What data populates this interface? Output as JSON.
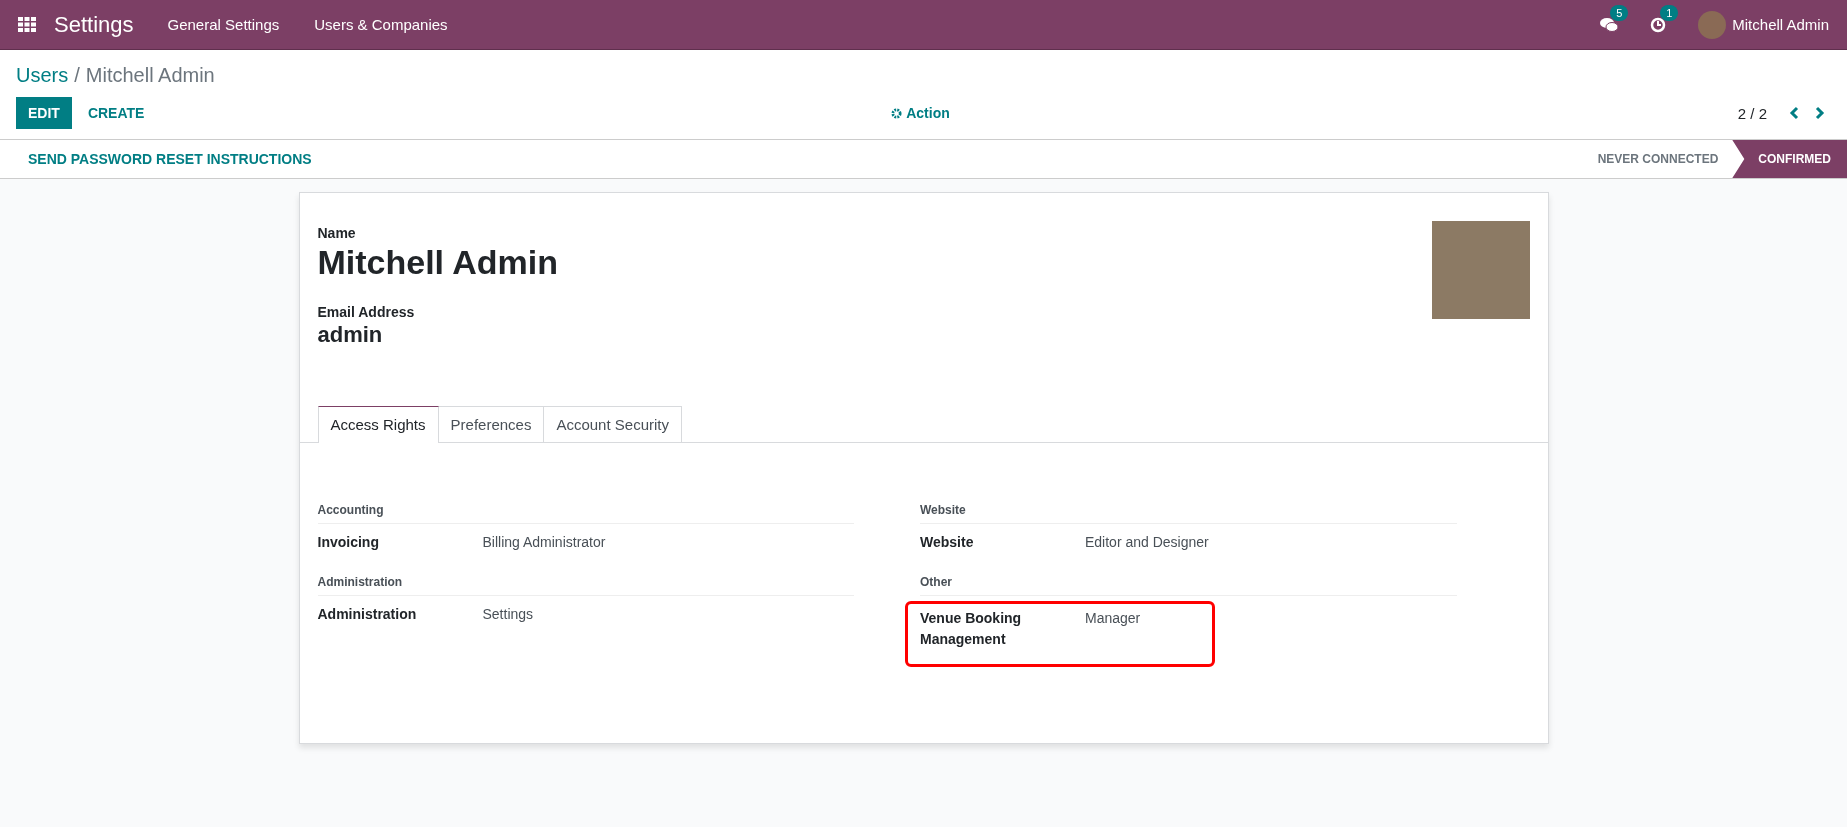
{
  "navbar": {
    "app_title": "Settings",
    "menu": [
      "General Settings",
      "Users & Companies"
    ],
    "messages_count": "5",
    "activities_count": "1",
    "user_name": "Mitchell Admin"
  },
  "breadcrumb": {
    "parent": "Users",
    "separator": "/",
    "current": "Mitchell Admin"
  },
  "control_panel": {
    "buttons": [
      {
        "label": "EDIT",
        "kind": "primary"
      },
      {
        "label": "CREATE",
        "kind": "link"
      }
    ],
    "action": "Action",
    "pager": "2 / 2"
  },
  "statusbar": {
    "button": "SEND PASSWORD RESET INSTRUCTIONS",
    "stages": [
      {
        "label": "NEVER CONNECTED",
        "selected": false
      },
      {
        "label": "CONFIRMED",
        "selected": true
      }
    ]
  },
  "form": {
    "name_label": "Name",
    "name": "Mitchell Admin",
    "email_label": "Email Address",
    "email": "admin",
    "tabs": [
      {
        "label": "Access Rights",
        "selected": true
      },
      {
        "label": "Preferences",
        "selected": false
      },
      {
        "label": "Account Security",
        "selected": false
      }
    ],
    "columns": [
      [
        {
          "title": "Accounting",
          "fields": [
            {
              "label": "Invoicing",
              "value": "Billing Administrator",
              "highlighted": false
            }
          ]
        },
        {
          "title": "Administration",
          "fields": [
            {
              "label": "Administration",
              "value": "Settings",
              "highlighted": false
            }
          ]
        }
      ],
      [
        {
          "title": "Website",
          "fields": [
            {
              "label": "Website",
              "value": "Editor and Designer",
              "highlighted": false
            }
          ]
        },
        {
          "title": "Other",
          "fields": [
            {
              "label": "Venue Booking Management",
              "value": "Manager",
              "highlighted": true
            }
          ]
        }
      ]
    ]
  }
}
